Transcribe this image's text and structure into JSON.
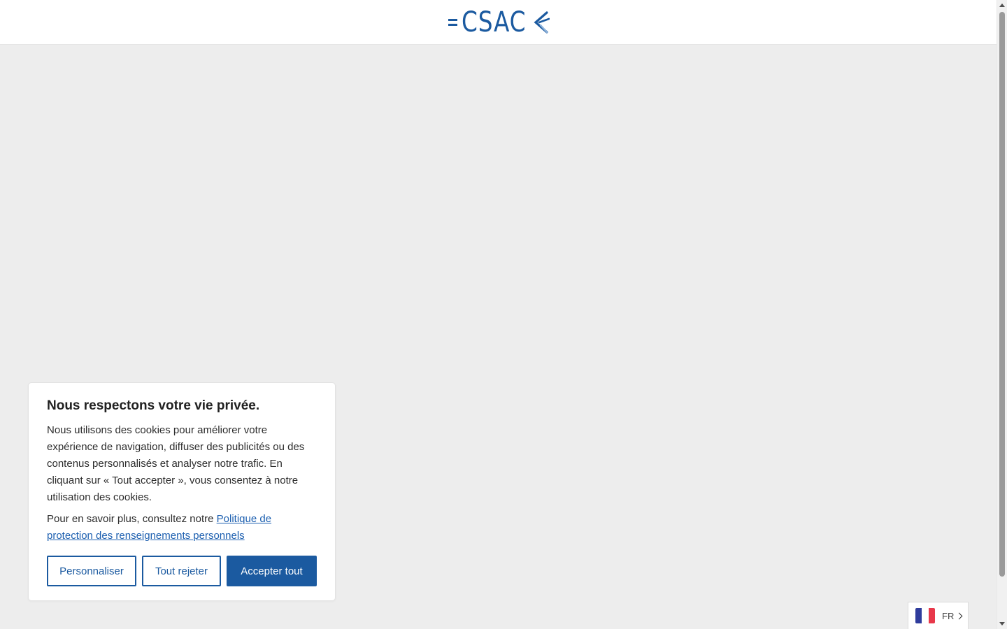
{
  "header": {
    "logo_text": "CSAC"
  },
  "cookie_banner": {
    "title": "Nous respectons votre vie privée.",
    "body": "Nous utilisons des cookies pour améliorer votre expérience de navigation, diffuser des publicités ou des contenus personnalisés et analyser notre trafic. En cliquant sur « Tout accepter », vous consentez à notre utilisation des cookies.",
    "more_prefix": "Pour en savoir plus, consultez notre ",
    "policy_link": "Politique de protection des renseignements personnels",
    "buttons": {
      "customize": "Personnaliser",
      "reject": "Tout rejeter",
      "accept": "Accepter tout"
    }
  },
  "language_selector": {
    "code": "FR",
    "flag_icon": "france-flag-icon",
    "flag_colors": [
      "#2f3c9c",
      "#ffffff",
      "#e8384a"
    ]
  },
  "colors": {
    "brand": "#1b5aa0",
    "page_background": "#ededed"
  }
}
